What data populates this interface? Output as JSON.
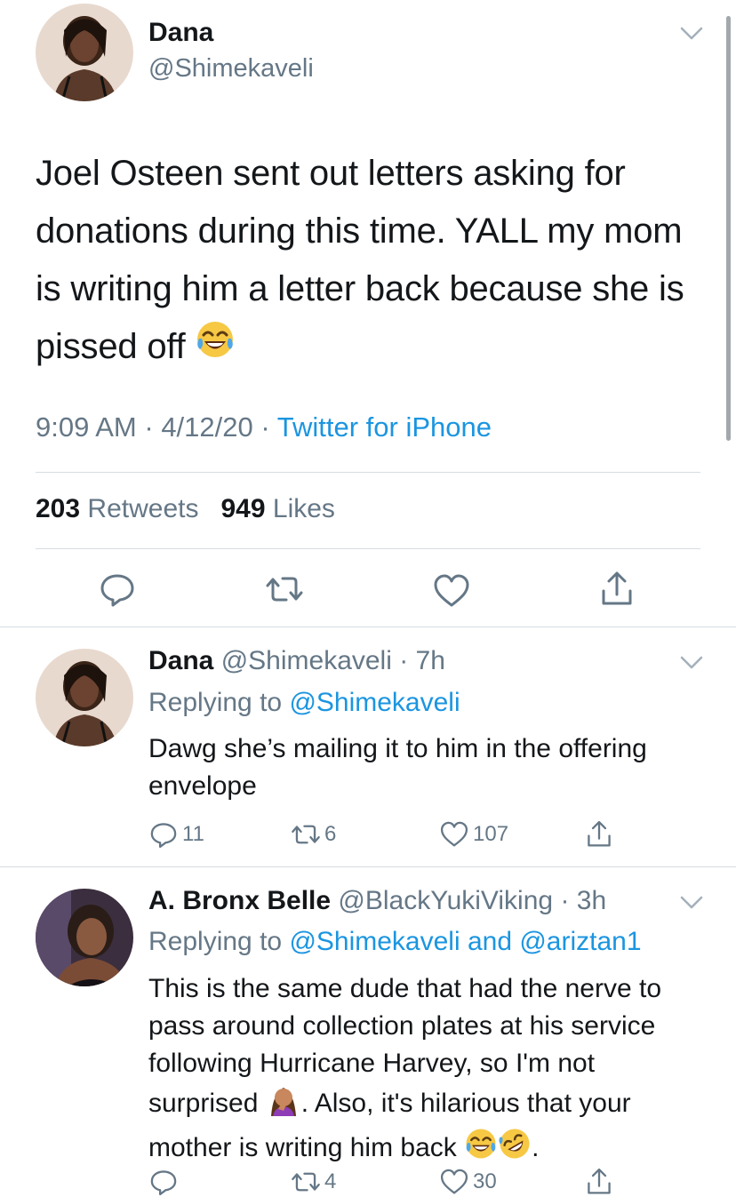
{
  "main_tweet": {
    "name": "Dana",
    "handle": "@Shimekaveli",
    "text": "Joel Osteen sent out letters asking for donations during this time. YALL my mom is writing him a letter back because she is pissed off",
    "emoji": "face-with-tears-of-joy",
    "time": "9:09 AM",
    "sep1": " · ",
    "date": "4/12/20",
    "sep2": " · ",
    "source": "Twitter for iPhone",
    "retweets_count": "203",
    "retweets_label": "Retweets",
    "likes_count": "949",
    "likes_label": "Likes"
  },
  "replies": [
    {
      "name": "Dana",
      "handle": "@Shimekaveli",
      "time": "· 7h",
      "replying_prefix": "Replying to",
      "replying_to": "@Shimekaveli",
      "text": "Dawg she’s mailing it to him in the offering envelope",
      "reply_count": "11",
      "retweet_count": "6",
      "like_count": "107"
    },
    {
      "name": "A. Bronx Belle",
      "handle": "@BlackYukiViking",
      "time": "· 3h",
      "replying_prefix": "Replying to",
      "replying_to": "@Shimekaveli and @ariztan1",
      "text_part1": "This is the same dude that had the nerve to pass around collection plates at his service following Hurricane Harvey, so I'm not surprised",
      "text_part2": ". Also, it's hilarious that your mother is writing him back",
      "text_part3": ".",
      "emoji_1": "woman-facepalming",
      "emoji_2": "face-with-tears-of-joy",
      "emoji_3": "rolling-on-the-floor-laughing",
      "reply_count": "",
      "retweet_count": "4",
      "like_count": "30"
    }
  ],
  "colors": {
    "text": "#14171a",
    "secondary": "#657786",
    "link": "#1b95e0",
    "divider": "#d7dde2"
  }
}
